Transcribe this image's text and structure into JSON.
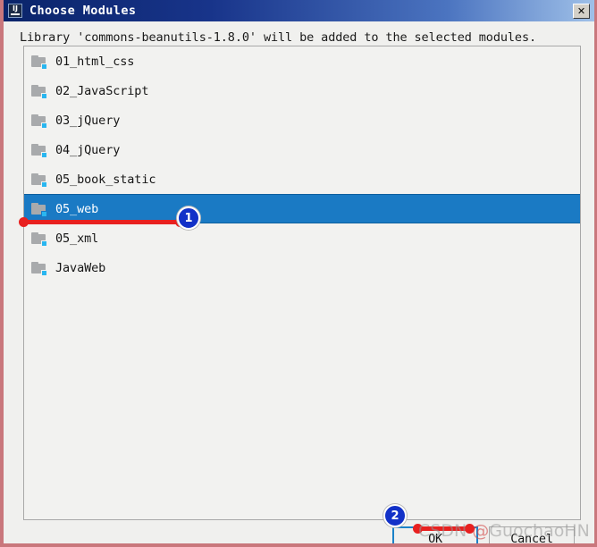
{
  "window": {
    "title": "Choose Modules",
    "app_icon": "intellij-idea-icon",
    "close_label": "✕"
  },
  "dialog": {
    "message": "Library 'commons-beanutils-1.8.0' will be added to the selected modules."
  },
  "module_list": {
    "items": [
      {
        "label": "01_html_css",
        "icon": "module-folder-icon",
        "selected": false
      },
      {
        "label": "02_JavaScript",
        "icon": "module-folder-icon",
        "selected": false
      },
      {
        "label": "03_jQuery",
        "icon": "module-folder-icon",
        "selected": false
      },
      {
        "label": "04_jQuery",
        "icon": "module-folder-icon",
        "selected": false
      },
      {
        "label": "05_book_static",
        "icon": "module-folder-icon",
        "selected": false
      },
      {
        "label": "05_web",
        "icon": "module-folder-icon",
        "selected": true
      },
      {
        "label": "05_xml",
        "icon": "module-folder-icon",
        "selected": false
      },
      {
        "label": "JavaWeb",
        "icon": "module-folder-icon",
        "selected": false
      }
    ]
  },
  "buttons": {
    "ok": "OK",
    "cancel": "Cancel"
  },
  "annotations": [
    {
      "number": "1",
      "target": "selected-module-row"
    },
    {
      "number": "2",
      "target": "ok-button"
    }
  ],
  "watermark": {
    "prefix": "CSDN ",
    "at": "@",
    "user": "GuochaoHN"
  },
  "colors": {
    "titlebar_start": "#0a246a",
    "titlebar_end": "#9fc0e8",
    "selection": "#1a7ac4",
    "annotation_red": "#e8201f",
    "annotation_badge_blue": "#1231c8",
    "default_button_border": "#1b82c8",
    "folder_badge": "#29b6f0",
    "frame_border": "#c9777c"
  }
}
